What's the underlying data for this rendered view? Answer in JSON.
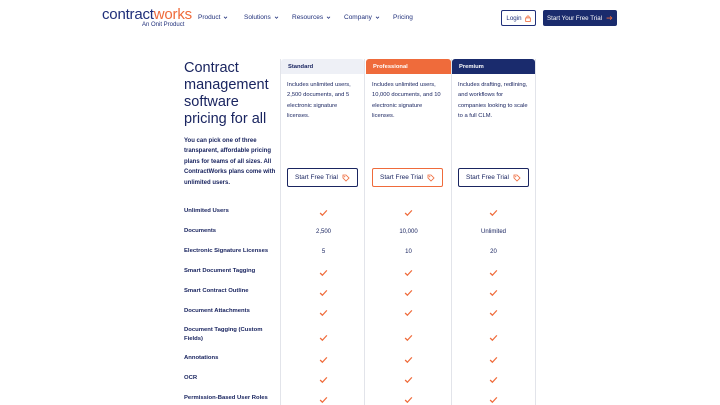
{
  "brand": {
    "name_part1": "contract",
    "name_part2": "works",
    "tagline": "An Onit Product",
    "accent": "#ef6b3b",
    "primary": "#1a2b6d"
  },
  "nav": {
    "items": [
      {
        "label": "Product",
        "dropdown": true
      },
      {
        "label": "Solutions",
        "dropdown": true
      },
      {
        "label": "Resources",
        "dropdown": true
      },
      {
        "label": "Company",
        "dropdown": true
      },
      {
        "label": "Pricing",
        "dropdown": false
      }
    ],
    "login_label": "Login",
    "login_icon": "lock-icon",
    "trial_label": "Start Your Free Trial",
    "trial_icon": "arrow-right-icon"
  },
  "hero": {
    "title": "Contract management software pricing for all",
    "description": "You can pick one of three transparent, affordable pricing plans for teams of all sizes. All ContractWorks plans come with unlimited users."
  },
  "plans": [
    {
      "name": "Standard",
      "header_bg": "#eef0f6",
      "header_color": "#1a2560",
      "description": "Includes unlimited users, 2,500 documents, and 5 electronic signature licenses.",
      "button_label": "Start Free Trial",
      "button_icon": "tag-icon"
    },
    {
      "name": "Professional",
      "header_bg": "#ef6b3b",
      "header_color": "#ffffff",
      "description": "Includes unlimited users, 10,000 documents, and 10 electronic signature licenses.",
      "button_label": "Start Free Trial",
      "button_icon": "tag-icon"
    },
    {
      "name": "Premium",
      "header_bg": "#1a2b6d",
      "header_color": "#ffffff",
      "description": "Includes drafting, redlining, and workflows for companies looking to scale to a full CLM.",
      "button_label": "Start Free Trial",
      "button_icon": "tag-icon"
    }
  ],
  "features": [
    {
      "label": "Unlimited Users",
      "values": [
        "check",
        "check",
        "check"
      ]
    },
    {
      "label": "Documents",
      "values": [
        "2,500",
        "10,000",
        "Unlimited"
      ]
    },
    {
      "label": "Electronic Signature Licenses",
      "values": [
        "5",
        "10",
        "20"
      ]
    },
    {
      "label": "Smart Document Tagging",
      "values": [
        "check",
        "check",
        "check"
      ]
    },
    {
      "label": "Smart Contract Outline",
      "values": [
        "check",
        "check",
        "check"
      ]
    },
    {
      "label": "Document Attachments",
      "values": [
        "check",
        "check",
        "check"
      ]
    },
    {
      "label": "Document Tagging (Custom Fields)",
      "values": [
        "check",
        "check",
        "check"
      ]
    },
    {
      "label": "Annotations",
      "values": [
        "check",
        "check",
        "check"
      ]
    },
    {
      "label": "OCR",
      "values": [
        "check",
        "check",
        "check"
      ]
    },
    {
      "label": "Permission-Based User Roles",
      "values": [
        "check",
        "check",
        "check"
      ]
    }
  ]
}
